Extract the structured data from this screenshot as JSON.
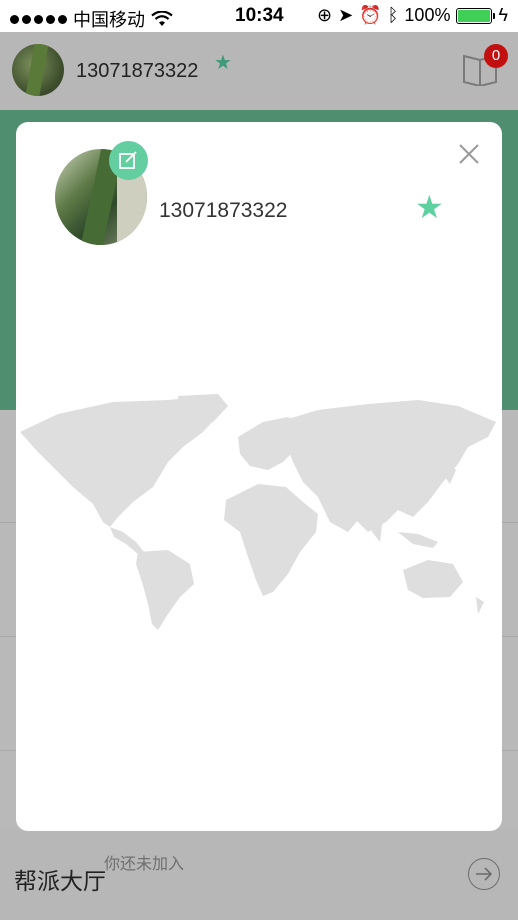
{
  "status_bar": {
    "carrier": "中国移动",
    "time": "10:34",
    "battery": "100%",
    "battery_level": 1.0
  },
  "header": {
    "phone": "13071873322",
    "badge_count": "0"
  },
  "card": {
    "phone": "13071873322"
  },
  "bottom": {
    "title": "帮派大厅",
    "status": "你还未加入"
  },
  "colors": {
    "accent": "#63cfa1",
    "badge": "#c21010",
    "overlay": "#b9b9b9"
  }
}
